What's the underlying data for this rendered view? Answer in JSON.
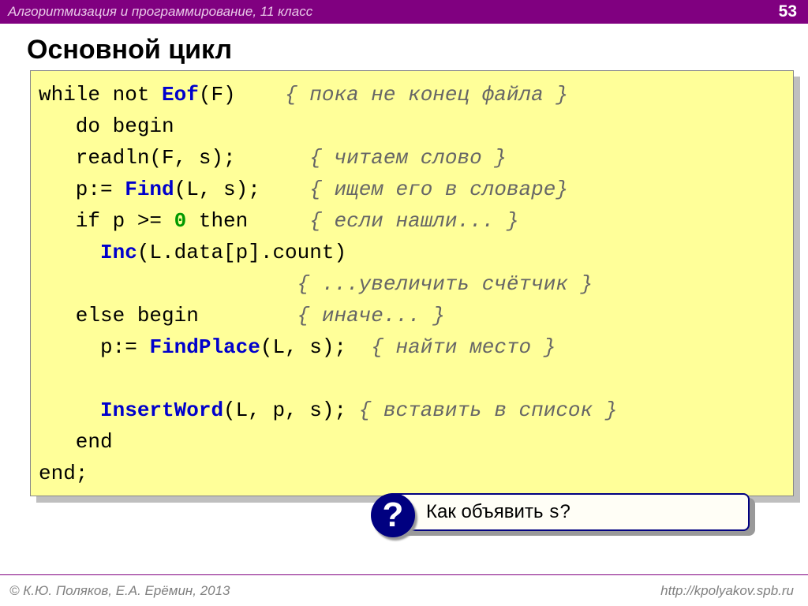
{
  "header": {
    "subject": "Алгоритмизация и программирование, 11 класс",
    "page": "53"
  },
  "title": "Основной цикл",
  "code": {
    "l1a": "while not ",
    "l1fn": "Eof",
    "l1b": "(F)    ",
    "l1c": "{ пока не конец файла }",
    "l2a": "   do begin",
    "l3a": "   readln(F, s);      ",
    "l3c": "{ читаем слово }",
    "l4a": "   p:= ",
    "l4fn": "Find",
    "l4b": "(L, s);    ",
    "l4c": "{ ищем его в словаре}",
    "l5a": "   if p >= ",
    "l5n": "0",
    "l5b": " then     ",
    "l5c": "{ если нашли... }",
    "l6a": "     ",
    "l6fn": "Inc",
    "l6b": "(L.data[p].count)",
    "l7a": "                     ",
    "l7c": "{ ...увеличить счётчик }",
    "l8a": "   else begin        ",
    "l8c": "{ иначе... }",
    "l9a": "     p:= ",
    "l9fn": "FindPlace",
    "l9b": "(L, s);  ",
    "l9c": "{ найти место }",
    "blank": " ",
    "l10a": "     ",
    "l10fn": "InsertWord",
    "l10b": "(L, p, s); ",
    "l10c": "{ вставить в список }",
    "l11": "   end",
    "l12": "end;"
  },
  "callout": {
    "badge": "?",
    "text_a": "Как объявить ",
    "text_code": "s",
    "text_b": "?"
  },
  "footer": {
    "left": "© К.Ю. Поляков, Е.А. Ерёмин, 2013",
    "right": "http://kpolyakov.spb.ru"
  }
}
